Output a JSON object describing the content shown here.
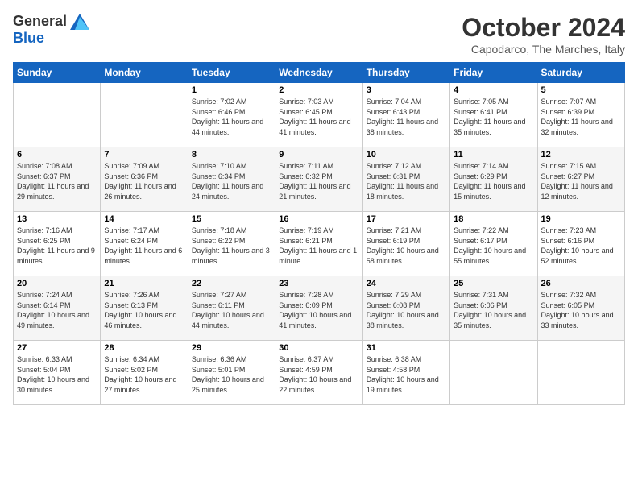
{
  "header": {
    "logo_general": "General",
    "logo_blue": "Blue",
    "month": "October 2024",
    "location": "Capodarco, The Marches, Italy"
  },
  "days_of_week": [
    "Sunday",
    "Monday",
    "Tuesday",
    "Wednesday",
    "Thursday",
    "Friday",
    "Saturday"
  ],
  "weeks": [
    [
      {
        "day": "",
        "info": ""
      },
      {
        "day": "",
        "info": ""
      },
      {
        "day": "1",
        "info": "Sunrise: 7:02 AM\nSunset: 6:46 PM\nDaylight: 11 hours and 44 minutes."
      },
      {
        "day": "2",
        "info": "Sunrise: 7:03 AM\nSunset: 6:45 PM\nDaylight: 11 hours and 41 minutes."
      },
      {
        "day": "3",
        "info": "Sunrise: 7:04 AM\nSunset: 6:43 PM\nDaylight: 11 hours and 38 minutes."
      },
      {
        "day": "4",
        "info": "Sunrise: 7:05 AM\nSunset: 6:41 PM\nDaylight: 11 hours and 35 minutes."
      },
      {
        "day": "5",
        "info": "Sunrise: 7:07 AM\nSunset: 6:39 PM\nDaylight: 11 hours and 32 minutes."
      }
    ],
    [
      {
        "day": "6",
        "info": "Sunrise: 7:08 AM\nSunset: 6:37 PM\nDaylight: 11 hours and 29 minutes."
      },
      {
        "day": "7",
        "info": "Sunrise: 7:09 AM\nSunset: 6:36 PM\nDaylight: 11 hours and 26 minutes."
      },
      {
        "day": "8",
        "info": "Sunrise: 7:10 AM\nSunset: 6:34 PM\nDaylight: 11 hours and 24 minutes."
      },
      {
        "day": "9",
        "info": "Sunrise: 7:11 AM\nSunset: 6:32 PM\nDaylight: 11 hours and 21 minutes."
      },
      {
        "day": "10",
        "info": "Sunrise: 7:12 AM\nSunset: 6:31 PM\nDaylight: 11 hours and 18 minutes."
      },
      {
        "day": "11",
        "info": "Sunrise: 7:14 AM\nSunset: 6:29 PM\nDaylight: 11 hours and 15 minutes."
      },
      {
        "day": "12",
        "info": "Sunrise: 7:15 AM\nSunset: 6:27 PM\nDaylight: 11 hours and 12 minutes."
      }
    ],
    [
      {
        "day": "13",
        "info": "Sunrise: 7:16 AM\nSunset: 6:25 PM\nDaylight: 11 hours and 9 minutes."
      },
      {
        "day": "14",
        "info": "Sunrise: 7:17 AM\nSunset: 6:24 PM\nDaylight: 11 hours and 6 minutes."
      },
      {
        "day": "15",
        "info": "Sunrise: 7:18 AM\nSunset: 6:22 PM\nDaylight: 11 hours and 3 minutes."
      },
      {
        "day": "16",
        "info": "Sunrise: 7:19 AM\nSunset: 6:21 PM\nDaylight: 11 hours and 1 minute."
      },
      {
        "day": "17",
        "info": "Sunrise: 7:21 AM\nSunset: 6:19 PM\nDaylight: 10 hours and 58 minutes."
      },
      {
        "day": "18",
        "info": "Sunrise: 7:22 AM\nSunset: 6:17 PM\nDaylight: 10 hours and 55 minutes."
      },
      {
        "day": "19",
        "info": "Sunrise: 7:23 AM\nSunset: 6:16 PM\nDaylight: 10 hours and 52 minutes."
      }
    ],
    [
      {
        "day": "20",
        "info": "Sunrise: 7:24 AM\nSunset: 6:14 PM\nDaylight: 10 hours and 49 minutes."
      },
      {
        "day": "21",
        "info": "Sunrise: 7:26 AM\nSunset: 6:13 PM\nDaylight: 10 hours and 46 minutes."
      },
      {
        "day": "22",
        "info": "Sunrise: 7:27 AM\nSunset: 6:11 PM\nDaylight: 10 hours and 44 minutes."
      },
      {
        "day": "23",
        "info": "Sunrise: 7:28 AM\nSunset: 6:09 PM\nDaylight: 10 hours and 41 minutes."
      },
      {
        "day": "24",
        "info": "Sunrise: 7:29 AM\nSunset: 6:08 PM\nDaylight: 10 hours and 38 minutes."
      },
      {
        "day": "25",
        "info": "Sunrise: 7:31 AM\nSunset: 6:06 PM\nDaylight: 10 hours and 35 minutes."
      },
      {
        "day": "26",
        "info": "Sunrise: 7:32 AM\nSunset: 6:05 PM\nDaylight: 10 hours and 33 minutes."
      }
    ],
    [
      {
        "day": "27",
        "info": "Sunrise: 6:33 AM\nSunset: 5:04 PM\nDaylight: 10 hours and 30 minutes."
      },
      {
        "day": "28",
        "info": "Sunrise: 6:34 AM\nSunset: 5:02 PM\nDaylight: 10 hours and 27 minutes."
      },
      {
        "day": "29",
        "info": "Sunrise: 6:36 AM\nSunset: 5:01 PM\nDaylight: 10 hours and 25 minutes."
      },
      {
        "day": "30",
        "info": "Sunrise: 6:37 AM\nSunset: 4:59 PM\nDaylight: 10 hours and 22 minutes."
      },
      {
        "day": "31",
        "info": "Sunrise: 6:38 AM\nSunset: 4:58 PM\nDaylight: 10 hours and 19 minutes."
      },
      {
        "day": "",
        "info": ""
      },
      {
        "day": "",
        "info": ""
      }
    ]
  ]
}
